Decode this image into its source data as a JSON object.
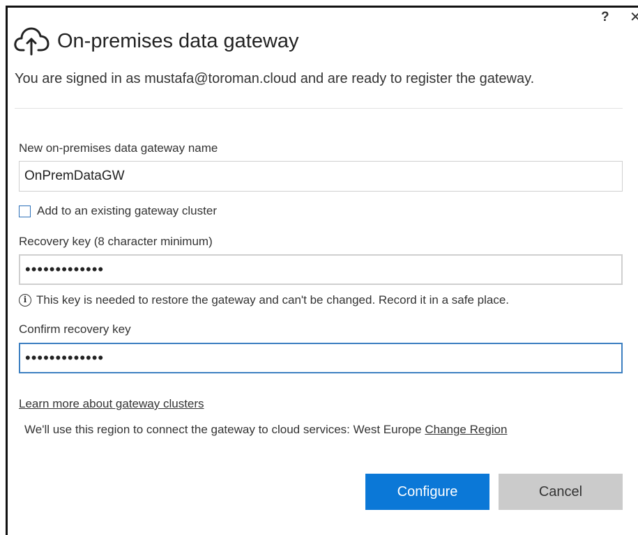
{
  "window": {
    "help_label": "?",
    "close_label": "✕"
  },
  "header": {
    "icon": "cloud-upload-icon",
    "title": "On-premises data gateway"
  },
  "signed_in_text": "You are signed in as mustafa@toroman.cloud and are ready to register the gateway.",
  "form": {
    "gateway_name": {
      "label": "New on-premises data gateway name",
      "value": "OnPremDataGW"
    },
    "cluster_checkbox": {
      "label": "Add to an existing gateway cluster",
      "checked": false
    },
    "recovery_key": {
      "label": "Recovery key (8 character minimum)",
      "value": "•••••••••••••"
    },
    "info": {
      "icon": "info-icon",
      "text": "This key is needed to restore the gateway and can't be changed. Record it in a safe place."
    },
    "confirm_key": {
      "label": "Confirm recovery key",
      "value": "•••••••••••••"
    }
  },
  "learn_more_link": "Learn more about gateway clusters",
  "region": {
    "text": "We'll use this region to connect the gateway to cloud services: West Europe ",
    "change_link": "Change Region"
  },
  "buttons": {
    "configure": "Configure",
    "cancel": "Cancel"
  },
  "colors": {
    "primary": "#0b78d7",
    "secondary": "#cbcbcb",
    "focus_border": "#3c7fc1"
  }
}
